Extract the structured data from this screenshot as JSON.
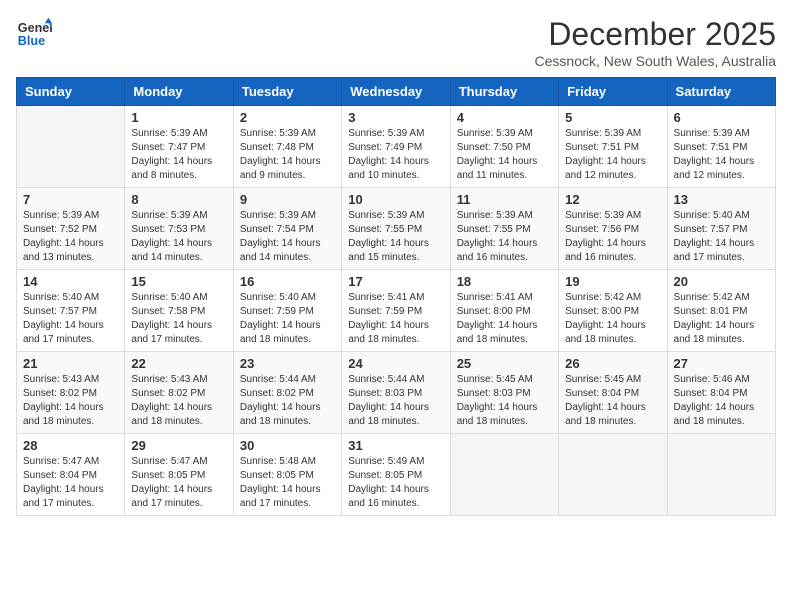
{
  "header": {
    "logo_line1": "General",
    "logo_line2": "Blue",
    "month_title": "December 2025",
    "subtitle": "Cessnock, New South Wales, Australia"
  },
  "days_of_week": [
    "Sunday",
    "Monday",
    "Tuesday",
    "Wednesday",
    "Thursday",
    "Friday",
    "Saturday"
  ],
  "weeks": [
    [
      {
        "day": "",
        "info": ""
      },
      {
        "day": "1",
        "info": "Sunrise: 5:39 AM\nSunset: 7:47 PM\nDaylight: 14 hours\nand 8 minutes."
      },
      {
        "day": "2",
        "info": "Sunrise: 5:39 AM\nSunset: 7:48 PM\nDaylight: 14 hours\nand 9 minutes."
      },
      {
        "day": "3",
        "info": "Sunrise: 5:39 AM\nSunset: 7:49 PM\nDaylight: 14 hours\nand 10 minutes."
      },
      {
        "day": "4",
        "info": "Sunrise: 5:39 AM\nSunset: 7:50 PM\nDaylight: 14 hours\nand 11 minutes."
      },
      {
        "day": "5",
        "info": "Sunrise: 5:39 AM\nSunset: 7:51 PM\nDaylight: 14 hours\nand 12 minutes."
      },
      {
        "day": "6",
        "info": "Sunrise: 5:39 AM\nSunset: 7:51 PM\nDaylight: 14 hours\nand 12 minutes."
      }
    ],
    [
      {
        "day": "7",
        "info": "Sunrise: 5:39 AM\nSunset: 7:52 PM\nDaylight: 14 hours\nand 13 minutes."
      },
      {
        "day": "8",
        "info": "Sunrise: 5:39 AM\nSunset: 7:53 PM\nDaylight: 14 hours\nand 14 minutes."
      },
      {
        "day": "9",
        "info": "Sunrise: 5:39 AM\nSunset: 7:54 PM\nDaylight: 14 hours\nand 14 minutes."
      },
      {
        "day": "10",
        "info": "Sunrise: 5:39 AM\nSunset: 7:55 PM\nDaylight: 14 hours\nand 15 minutes."
      },
      {
        "day": "11",
        "info": "Sunrise: 5:39 AM\nSunset: 7:55 PM\nDaylight: 14 hours\nand 16 minutes."
      },
      {
        "day": "12",
        "info": "Sunrise: 5:39 AM\nSunset: 7:56 PM\nDaylight: 14 hours\nand 16 minutes."
      },
      {
        "day": "13",
        "info": "Sunrise: 5:40 AM\nSunset: 7:57 PM\nDaylight: 14 hours\nand 17 minutes."
      }
    ],
    [
      {
        "day": "14",
        "info": "Sunrise: 5:40 AM\nSunset: 7:57 PM\nDaylight: 14 hours\nand 17 minutes."
      },
      {
        "day": "15",
        "info": "Sunrise: 5:40 AM\nSunset: 7:58 PM\nDaylight: 14 hours\nand 17 minutes."
      },
      {
        "day": "16",
        "info": "Sunrise: 5:40 AM\nSunset: 7:59 PM\nDaylight: 14 hours\nand 18 minutes."
      },
      {
        "day": "17",
        "info": "Sunrise: 5:41 AM\nSunset: 7:59 PM\nDaylight: 14 hours\nand 18 minutes."
      },
      {
        "day": "18",
        "info": "Sunrise: 5:41 AM\nSunset: 8:00 PM\nDaylight: 14 hours\nand 18 minutes."
      },
      {
        "day": "19",
        "info": "Sunrise: 5:42 AM\nSunset: 8:00 PM\nDaylight: 14 hours\nand 18 minutes."
      },
      {
        "day": "20",
        "info": "Sunrise: 5:42 AM\nSunset: 8:01 PM\nDaylight: 14 hours\nand 18 minutes."
      }
    ],
    [
      {
        "day": "21",
        "info": "Sunrise: 5:43 AM\nSunset: 8:02 PM\nDaylight: 14 hours\nand 18 minutes."
      },
      {
        "day": "22",
        "info": "Sunrise: 5:43 AM\nSunset: 8:02 PM\nDaylight: 14 hours\nand 18 minutes."
      },
      {
        "day": "23",
        "info": "Sunrise: 5:44 AM\nSunset: 8:02 PM\nDaylight: 14 hours\nand 18 minutes."
      },
      {
        "day": "24",
        "info": "Sunrise: 5:44 AM\nSunset: 8:03 PM\nDaylight: 14 hours\nand 18 minutes."
      },
      {
        "day": "25",
        "info": "Sunrise: 5:45 AM\nSunset: 8:03 PM\nDaylight: 14 hours\nand 18 minutes."
      },
      {
        "day": "26",
        "info": "Sunrise: 5:45 AM\nSunset: 8:04 PM\nDaylight: 14 hours\nand 18 minutes."
      },
      {
        "day": "27",
        "info": "Sunrise: 5:46 AM\nSunset: 8:04 PM\nDaylight: 14 hours\nand 18 minutes."
      }
    ],
    [
      {
        "day": "28",
        "info": "Sunrise: 5:47 AM\nSunset: 8:04 PM\nDaylight: 14 hours\nand 17 minutes."
      },
      {
        "day": "29",
        "info": "Sunrise: 5:47 AM\nSunset: 8:05 PM\nDaylight: 14 hours\nand 17 minutes."
      },
      {
        "day": "30",
        "info": "Sunrise: 5:48 AM\nSunset: 8:05 PM\nDaylight: 14 hours\nand 17 minutes."
      },
      {
        "day": "31",
        "info": "Sunrise: 5:49 AM\nSunset: 8:05 PM\nDaylight: 14 hours\nand 16 minutes."
      },
      {
        "day": "",
        "info": ""
      },
      {
        "day": "",
        "info": ""
      },
      {
        "day": "",
        "info": ""
      }
    ]
  ]
}
